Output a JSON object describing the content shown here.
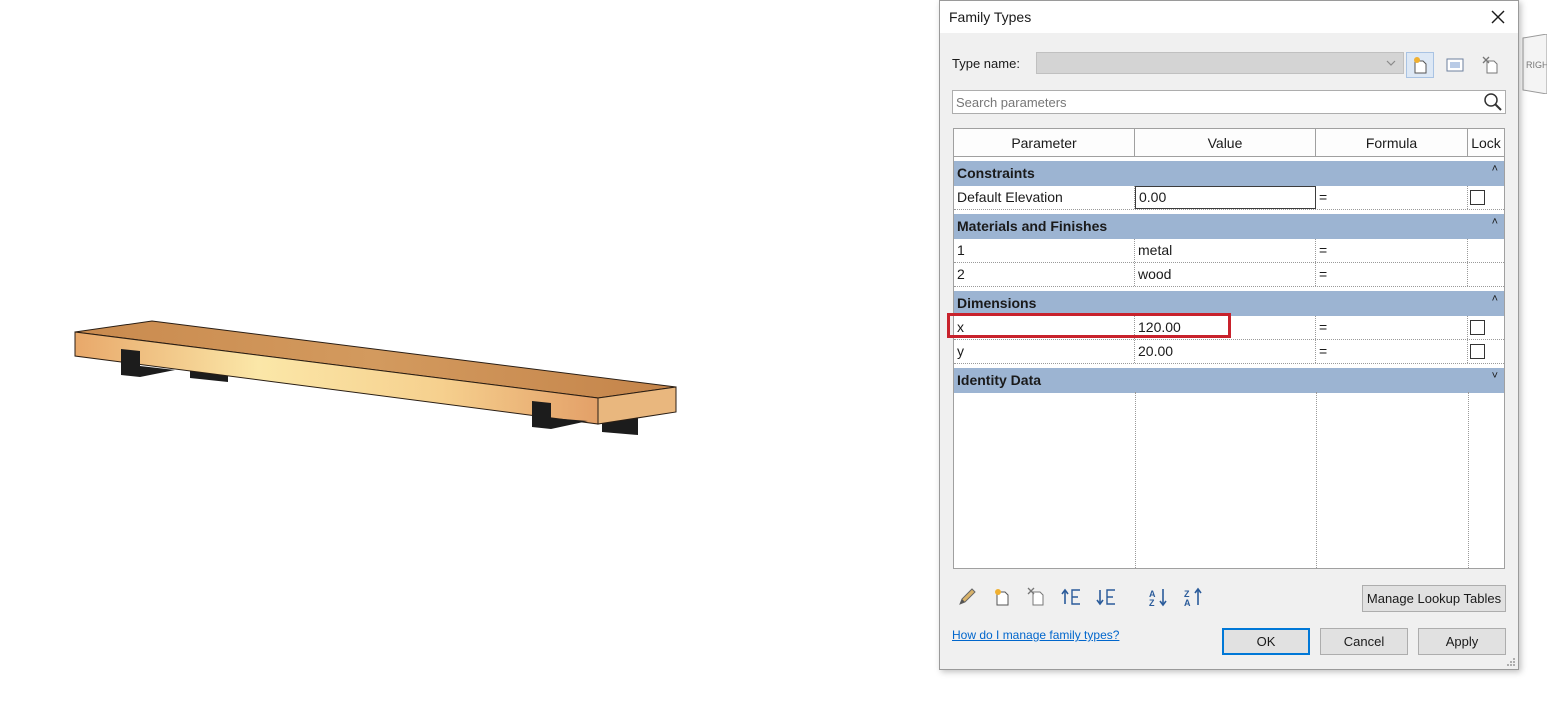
{
  "dialog": {
    "title": "Family Types",
    "type_name_label": "Type name:",
    "type_name_value": "",
    "search_placeholder": "Search parameters",
    "columns": [
      "Parameter",
      "Value",
      "Formula",
      "Lock"
    ],
    "groups": [
      {
        "name": "Constraints",
        "collapse_glyph": "˄",
        "rows": [
          {
            "param": "Default Elevation",
            "value": "0.00",
            "formula": "=",
            "lock": false
          }
        ]
      },
      {
        "name": "Materials and Finishes",
        "collapse_glyph": "˄",
        "rows": [
          {
            "param": "1",
            "value": "metal",
            "formula": "="
          },
          {
            "param": "2",
            "value": "wood",
            "formula": "="
          }
        ]
      },
      {
        "name": "Dimensions",
        "collapse_glyph": "˄",
        "rows": [
          {
            "param": "x",
            "value": "120.00",
            "formula": "=",
            "lock": false
          },
          {
            "param": "y",
            "value": "20.00",
            "formula": "=",
            "lock": false
          }
        ]
      },
      {
        "name": "Identity Data",
        "collapse_glyph": "˅",
        "rows": []
      }
    ],
    "manage_lookup_label": "Manage Lookup Tables",
    "help_link": "How do I manage family types?",
    "ok_label": "OK",
    "cancel_label": "Cancel",
    "apply_label": "Apply"
  },
  "viewcube_label": "RIGHT",
  "colors": {
    "group_header": "#9cb4d2",
    "highlight": "#c8222c",
    "link": "#0066cc"
  }
}
